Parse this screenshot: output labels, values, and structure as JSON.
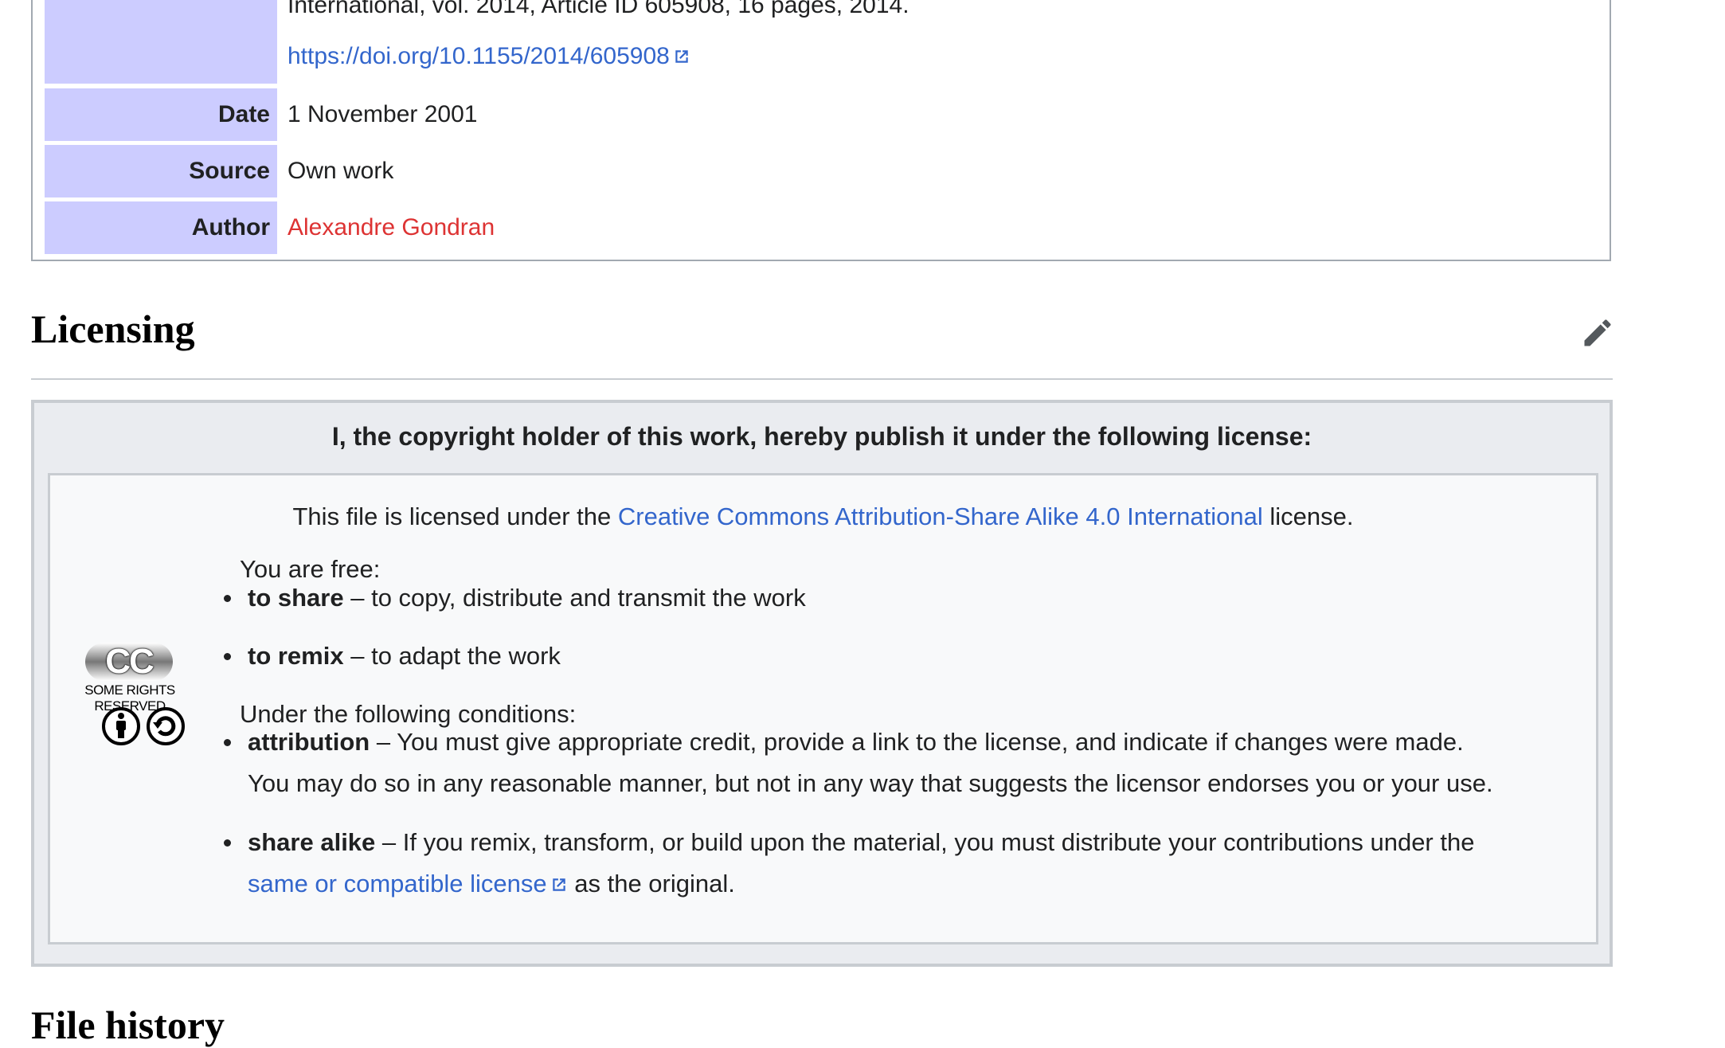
{
  "info": {
    "desc_cont_line": "International, vol. 2014, Article ID 605908, 16 pages, 2014.",
    "desc_doi": "https://doi.org/10.1155/2014/605908",
    "rows": [
      {
        "label": "Date",
        "value": "1 November 2001"
      },
      {
        "label": "Source",
        "value": "Own work"
      },
      {
        "label": "Author",
        "value": "Alexandre Gondran"
      }
    ]
  },
  "licensing": {
    "heading": "Licensing",
    "header": "I, the copyright holder of this work, hereby publish it under the following license:",
    "line_prefix": "This file is licensed under the ",
    "license_link": "Creative Commons Attribution-Share Alike 4.0 International",
    "line_suffix": " license.",
    "cc_badge": "CC",
    "cc_reserved": "SOME RIGHTS RESERVED",
    "free_label": "You are free:",
    "free_items": [
      {
        "term": "to share",
        "desc": " – to copy, distribute and transmit the work"
      },
      {
        "term": "to remix",
        "desc": " – to adapt the work"
      }
    ],
    "conditions_label": "Under the following conditions:",
    "attribution": {
      "term": "attribution",
      "desc_line1": " – You must give appropriate credit, provide a link to the license, and indicate if changes were made.",
      "desc_line2": "You may do so in any reasonable manner, but not in any way that suggests the licensor endorses you or your use."
    },
    "share_alike": {
      "term": "share alike",
      "desc_line1": " – If you remix, transform, or build upon the material, you must distribute your contributions under the",
      "link": "same or compatible license",
      "desc_line2_suffix": " as the original."
    }
  },
  "colors": {
    "label_bg": "#ccccff",
    "link": "#3366cc",
    "redlink": "#dd3333",
    "license_bg": "#eaecf0"
  },
  "icons": {
    "external": "external-link-icon",
    "edit": "pencil-icon",
    "cc_by": "attribution-icon",
    "cc_sa": "share-alike-icon"
  },
  "next_heading": "File history"
}
